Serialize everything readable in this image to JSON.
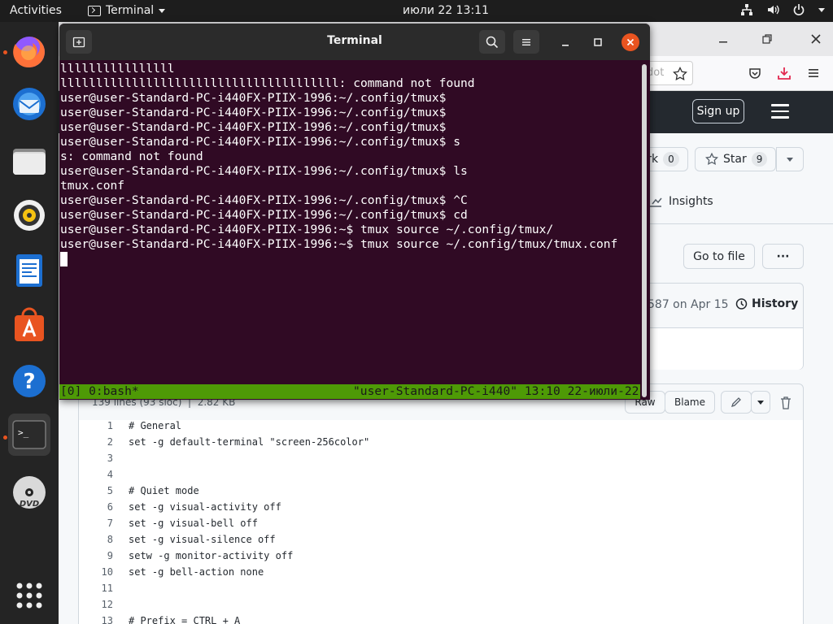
{
  "topbar": {
    "activities": "Activities",
    "app_menu": "Terminal",
    "clock": "июли 22  13:11"
  },
  "dock": {
    "items": [
      {
        "name": "firefox",
        "running": true
      },
      {
        "name": "thunderbird",
        "running": false
      },
      {
        "name": "files",
        "running": false
      },
      {
        "name": "rhythmbox",
        "running": false
      },
      {
        "name": "libreoffice-writer",
        "running": false
      },
      {
        "name": "ubuntu-software",
        "running": false
      },
      {
        "name": "help",
        "running": false
      },
      {
        "name": "terminal",
        "running": true
      },
      {
        "name": "dvd",
        "running": false
      },
      {
        "name": "show-applications",
        "running": false
      }
    ],
    "help_glyph": "?",
    "terminal_glyph": ">_",
    "dvd_label": "DVD"
  },
  "browser": {
    "url_fragment": "dot",
    "sign_up": "Sign up",
    "fork_label": "rk",
    "fork_count": "0",
    "star_label": "Star",
    "star_count": "9",
    "insights": "Insights",
    "go_to_file": "Go to file",
    "more": "···",
    "commit_info": "587 on Apr 15",
    "history": "History",
    "file_stats": "139 lines (93 sloc)  |  2.82 KB",
    "raw": "Raw",
    "blame": "Blame",
    "code_lines": [
      {
        "n": "1",
        "text": "# General"
      },
      {
        "n": "2",
        "text": "set -g default-terminal \"screen-256color\""
      },
      {
        "n": "3",
        "text": ""
      },
      {
        "n": "4",
        "text": ""
      },
      {
        "n": "5",
        "text": "# Quiet mode"
      },
      {
        "n": "6",
        "text": "set -g visual-activity off"
      },
      {
        "n": "7",
        "text": "set -g visual-bell off"
      },
      {
        "n": "8",
        "text": "set -g visual-silence off"
      },
      {
        "n": "9",
        "text": "setw -g monitor-activity off"
      },
      {
        "n": "10",
        "text": "set -g bell-action none"
      },
      {
        "n": "11",
        "text": ""
      },
      {
        "n": "12",
        "text": ""
      },
      {
        "n": "13",
        "text": "# Prefix = CTRL + A"
      }
    ]
  },
  "terminal": {
    "title": "Terminal",
    "lines": [
      "llllllllllllllll",
      "lllllllllllllllllllllllllllllllllllllll: command not found",
      "user@user-Standard-PC-i440FX-PIIX-1996:~/.config/tmux$",
      "user@user-Standard-PC-i440FX-PIIX-1996:~/.config/tmux$",
      "user@user-Standard-PC-i440FX-PIIX-1996:~/.config/tmux$",
      "user@user-Standard-PC-i440FX-PIIX-1996:~/.config/tmux$ s",
      "s: command not found",
      "user@user-Standard-PC-i440FX-PIIX-1996:~/.config/tmux$ ls",
      "tmux.conf",
      "user@user-Standard-PC-i440FX-PIIX-1996:~/.config/tmux$ ^C",
      "user@user-Standard-PC-i440FX-PIIX-1996:~/.config/tmux$ cd",
      "user@user-Standard-PC-i440FX-PIIX-1996:~$ tmux source ~/.config/tmux/",
      "user@user-Standard-PC-i440FX-PIIX-1996:~$ tmux source ~/.config/tmux/tmux.conf"
    ],
    "tmux_left": "[0] 0:bash*",
    "tmux_right": "\"user-Standard-PC-i440\" 13:10 22-июли-22"
  },
  "colors": {
    "terminal_bg": "#300a24",
    "tmux_status": "#4e9a06",
    "close_button": "#e95420",
    "topbar_bg": "#1d1d1d",
    "dock_bg": "#242424"
  }
}
